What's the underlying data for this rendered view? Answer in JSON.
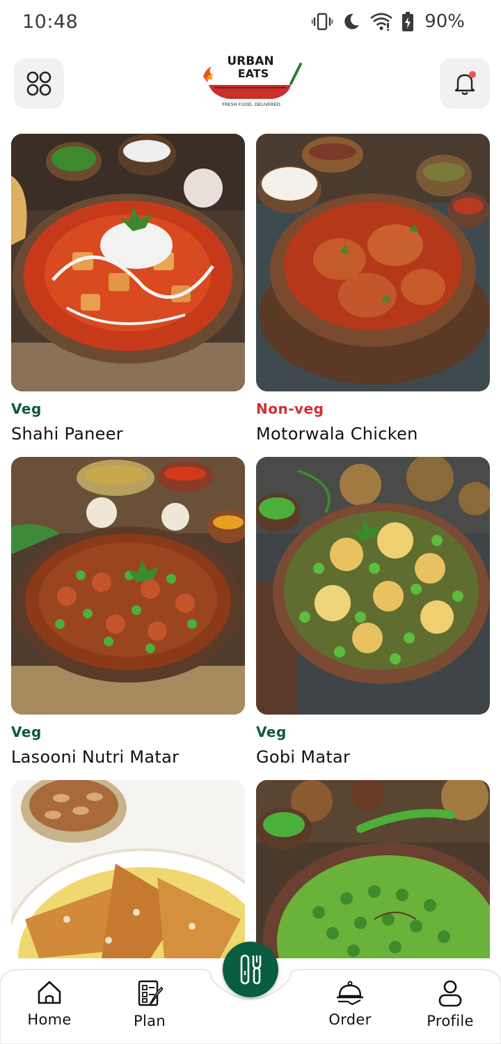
{
  "status_bar": {
    "time": "10:48",
    "battery": "90%",
    "icons": [
      "vibrate-icon",
      "dnd-moon-icon",
      "wifi-icon",
      "battery-charging-icon"
    ]
  },
  "header": {
    "logo_line1": "URBAN",
    "logo_line2": "EATS",
    "logo_tagline": "FRESH FOOD, DELIVERED.",
    "menu_icon": "grid-menu-icon",
    "notification_icon": "bell-icon",
    "notification_dot_color": "#ef5350"
  },
  "dishes": [
    {
      "type": "Veg",
      "name": "Shahi Paneer"
    },
    {
      "type": "Non-veg",
      "name": "Motorwala Chicken"
    },
    {
      "type": "Veg",
      "name": "Lasooni Nutri Matar"
    },
    {
      "type": "Veg",
      "name": "Gobi Matar"
    },
    {
      "type": "",
      "name": ""
    },
    {
      "type": "",
      "name": ""
    }
  ],
  "bottom_nav": {
    "home": "Home",
    "plan": "Plan",
    "order": "Order",
    "profile": "Profile",
    "center_icon": "cutlery-icon"
  },
  "colors": {
    "veg": "#0c5a3c",
    "nonveg": "#d32f2f",
    "brand_green": "#0b5d3f"
  }
}
